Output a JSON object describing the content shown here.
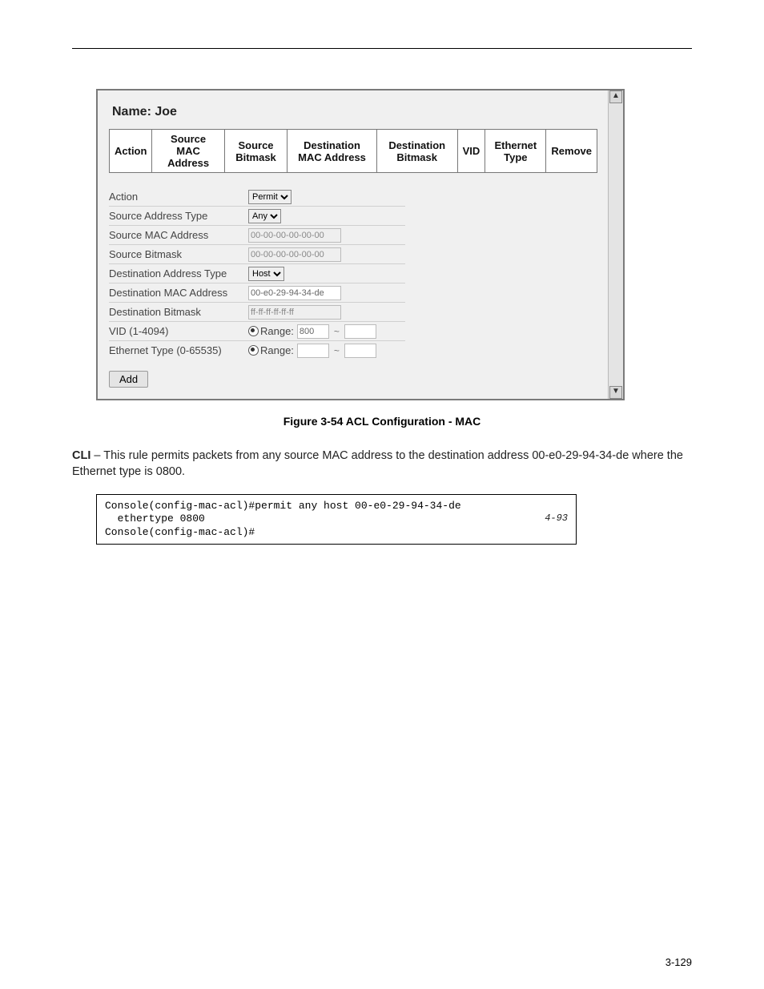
{
  "acl": {
    "title": "Name: Joe",
    "table_headers": [
      "Action",
      "Source MAC Address",
      "Source Bitmask",
      "Destination MAC Address",
      "Destination Bitmask",
      "VID",
      "Ethernet Type",
      "Remove"
    ],
    "form": {
      "action_label": "Action",
      "action_value": "Permit",
      "src_addr_type_label": "Source Address Type",
      "src_addr_type_value": "Any",
      "src_mac_label": "Source MAC Address",
      "src_mac_value": "00-00-00-00-00-00",
      "src_bitmask_label": "Source Bitmask",
      "src_bitmask_value": "00-00-00-00-00-00",
      "dst_addr_type_label": "Destination Address Type",
      "dst_addr_type_value": "Host",
      "dst_mac_label": "Destination MAC Address",
      "dst_mac_value": "00-e0-29-94-34-de",
      "dst_bitmask_label": "Destination Bitmask",
      "dst_bitmask_value": "ff-ff-ff-ff-ff-ff",
      "vid_label": "VID (1-4094)",
      "vid_range_label": "Range:",
      "vid_range_from": "800",
      "vid_range_to": "",
      "eth_label": "Ethernet Type (0-65535)",
      "eth_range_label": "Range:",
      "eth_range_from": "",
      "eth_range_to": ""
    },
    "add_button": "Add"
  },
  "figure_caption": "Figure 3-54   ACL Configuration - MAC",
  "cli_intro": "CLI – This rule permits packets from any source MAC address to the destination address 00-e0-29-94-34-de where the Ethernet type is 0800.",
  "cli_label": "CLI",
  "console": {
    "line1": "Console(config-mac-acl)#permit any host 00-e0-29-94-34-de",
    "line2": "  ethertype 0800",
    "line3": "Console(config-mac-acl)#",
    "ref": "4-93"
  },
  "page_number": "3-129"
}
